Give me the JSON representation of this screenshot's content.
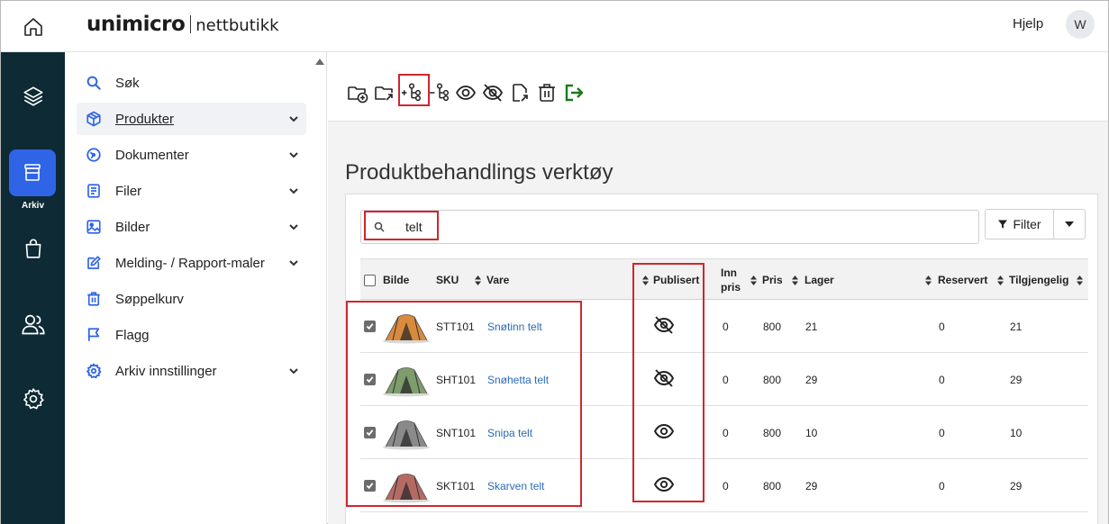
{
  "header": {
    "logo_main": "unimicro",
    "logo_sub": "nettbutikk",
    "help": "Hjelp",
    "avatar": "W"
  },
  "rail": {
    "active_label": "Arkiv"
  },
  "sidebar": {
    "items": [
      {
        "label": "Søk",
        "icon": "search-icon",
        "chevron": false
      },
      {
        "label": "Produkter",
        "icon": "box-icon",
        "chevron": true,
        "active": true
      },
      {
        "label": "Dokumenter",
        "icon": "document-icon",
        "chevron": true
      },
      {
        "label": "Filer",
        "icon": "file-list-icon",
        "chevron": true
      },
      {
        "label": "Bilder",
        "icon": "image-icon",
        "chevron": true
      },
      {
        "label": "Melding- / Rapport-maler",
        "icon": "edit-icon",
        "chevron": true
      },
      {
        "label": "Søppelkurv",
        "icon": "trash-icon",
        "chevron": false
      },
      {
        "label": "Flagg",
        "icon": "flag-icon",
        "chevron": false
      },
      {
        "label": "Arkiv innstillinger",
        "icon": "settings-icon",
        "chevron": true
      }
    ]
  },
  "main": {
    "title": "Produktbehandlings verktøy",
    "search_value": "telt",
    "filter_label": "Filter"
  },
  "table": {
    "columns": [
      "Bilde",
      "SKU",
      "Vare",
      "Publisert",
      "Inn pris",
      "Pris",
      "Lager",
      "Reservert",
      "Tilgjengelig"
    ],
    "rows": [
      {
        "sku": "STT101",
        "vare": "Snøtinn telt",
        "published": false,
        "inn_pris": "0",
        "pris": "800",
        "lager": "21",
        "reservert": "0",
        "tilgjengelig": "21",
        "tent_color": "#d98a3c"
      },
      {
        "sku": "SHT101",
        "vare": "Snøhetta telt",
        "published": false,
        "inn_pris": "0",
        "pris": "800",
        "lager": "29",
        "reservert": "0",
        "tilgjengelig": "29",
        "tent_color": "#7e9c6c"
      },
      {
        "sku": "SNT101",
        "vare": "Snipa telt",
        "published": true,
        "inn_pris": "0",
        "pris": "800",
        "lager": "10",
        "reservert": "0",
        "tilgjengelig": "10",
        "tent_color": "#8a8a8a"
      },
      {
        "sku": "SKT101",
        "vare": "Skarven telt",
        "published": true,
        "inn_pris": "0",
        "pris": "800",
        "lager": "29",
        "reservert": "0",
        "tilgjengelig": "29",
        "tent_color": "#b56a63"
      }
    ]
  },
  "colors": {
    "rail_bg": "#0d2a35",
    "accent": "#2f64e6",
    "link": "#2a6bb8",
    "highlight": "#d0262f",
    "exit_green": "#1b7a1b"
  }
}
